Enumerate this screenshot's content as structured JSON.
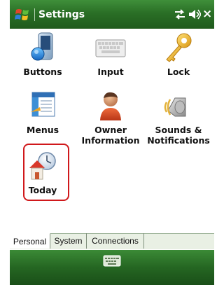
{
  "window": {
    "title": "Settings",
    "close_label": "×"
  },
  "icons": {
    "start": "windows-flag-icon",
    "connectivity": "connectivity-icon",
    "volume": "volume-icon",
    "keyboard": "keyboard-icon"
  },
  "items": {
    "buttons": {
      "label": "Buttons"
    },
    "input": {
      "label": "Input"
    },
    "lock": {
      "label": "Lock"
    },
    "menus": {
      "label": "Menus"
    },
    "owner": {
      "label_line1": "Owner",
      "label_line2": "Information"
    },
    "sounds": {
      "label_line1": "Sounds &",
      "label_line2": "Notifications"
    },
    "today": {
      "label": "Today",
      "highlighted": true
    }
  },
  "tabs": [
    {
      "label": "Personal",
      "active": true
    },
    {
      "label": "System",
      "active": false
    },
    {
      "label": "Connections",
      "active": false
    }
  ],
  "colors": {
    "title_bar": "#2a6f26",
    "highlight_border": "#d0181b"
  }
}
